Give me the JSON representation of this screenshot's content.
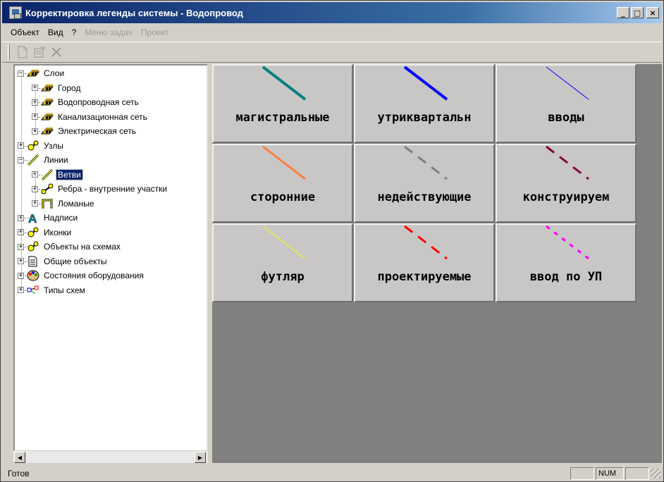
{
  "window": {
    "title": "Корректировка легенды системы - Водопровод",
    "controls": {
      "minimize": "_",
      "maximize": "□",
      "close": "×"
    }
  },
  "menu": [
    {
      "label": "Объект",
      "enabled": true
    },
    {
      "label": "Вид",
      "enabled": true
    },
    {
      "label": "?",
      "enabled": true
    },
    {
      "label": "Меню задач",
      "enabled": false
    },
    {
      "label": "Проект",
      "enabled": false
    }
  ],
  "toolbar": {
    "new_icon": "new-document-icon",
    "properties_icon": "properties-icon",
    "delete_icon": "delete-icon"
  },
  "tree": [
    {
      "label": "Слои",
      "icon": "layers-icon",
      "level": 0,
      "expanded": true
    },
    {
      "label": "Город",
      "icon": "layers-icon",
      "level": 1,
      "expanded": false
    },
    {
      "label": "Водопроводная сеть",
      "icon": "layers-icon",
      "level": 1,
      "expanded": false
    },
    {
      "label": "Канализационная сеть",
      "icon": "layers-icon",
      "level": 1,
      "expanded": false
    },
    {
      "label": "Электрическая сеть",
      "icon": "layers-icon",
      "level": 1,
      "expanded": false
    },
    {
      "label": "Узлы",
      "icon": "node-icon",
      "level": 0,
      "expanded": false
    },
    {
      "label": "Линии",
      "icon": "line-icon",
      "level": 0,
      "expanded": true
    },
    {
      "label": "Ветви",
      "icon": "line-icon",
      "level": 1,
      "expanded": false,
      "selected": true
    },
    {
      "label": "Ребра - внутренние участки",
      "icon": "edge-icon",
      "level": 1,
      "expanded": false
    },
    {
      "label": "Ломаные",
      "icon": "polyline-icon",
      "level": 1,
      "expanded": false
    },
    {
      "label": "Надписи",
      "icon": "text-icon",
      "level": 0,
      "expanded": false
    },
    {
      "label": "Иконки",
      "icon": "node-icon",
      "level": 0,
      "expanded": false
    },
    {
      "label": "Объекты на схемах",
      "icon": "node-icon",
      "level": 0,
      "expanded": false
    },
    {
      "label": "Общие объекты",
      "icon": "document-icon",
      "level": 0,
      "expanded": false
    },
    {
      "label": "Состояния оборудования",
      "icon": "palette-icon",
      "level": 0,
      "expanded": false
    },
    {
      "label": "Типы схем",
      "icon": "schema-icon",
      "level": 0,
      "expanded": false
    }
  ],
  "legend": [
    {
      "label": "магистральные",
      "color": "#008080",
      "style": "solid",
      "width": 4
    },
    {
      "label": "утриквартальн",
      "color": "#0000ff",
      "style": "solid",
      "width": 4
    },
    {
      "label": "вводы",
      "color": "#0000ff",
      "style": "solid",
      "width": 1
    },
    {
      "label": "сторонние",
      "color": "#ff8040",
      "style": "solid",
      "width": 3
    },
    {
      "label": "недействующие",
      "color": "#808080",
      "style": "dashed",
      "width": 3
    },
    {
      "label": "конструируем",
      "color": "#800040",
      "style": "dashed",
      "width": 3
    },
    {
      "label": "футляр",
      "color": "#ffff00",
      "style": "solid",
      "width": 1
    },
    {
      "label": "проектируемые",
      "color": "#ff0000",
      "style": "dashed",
      "width": 3
    },
    {
      "label": "ввод по УП",
      "color": "#ff00ff",
      "style": "dotted",
      "width": 3
    }
  ],
  "status": {
    "text": "Готов",
    "indicator_num": "NUM"
  }
}
